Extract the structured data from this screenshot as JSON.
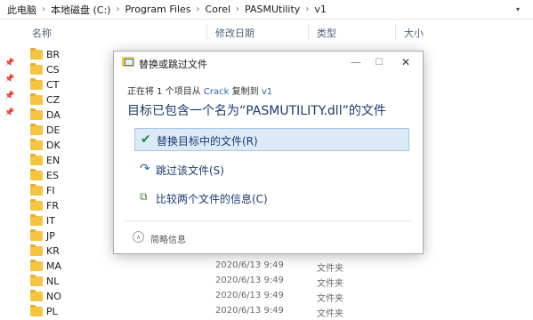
{
  "breadcrumb": [
    "此电脑",
    "本地磁盘 (C:)",
    "Program Files",
    "Corel",
    "PASMUtility",
    "v1"
  ],
  "columns": {
    "name": "名称",
    "modified": "修改日期",
    "type": "类型",
    "size": "大小"
  },
  "files": [
    {
      "name": "BR",
      "date": "",
      "type": ""
    },
    {
      "name": "CS",
      "date": "",
      "type": ""
    },
    {
      "name": "CT",
      "date": "",
      "type": ""
    },
    {
      "name": "CZ",
      "date": "",
      "type": ""
    },
    {
      "name": "DA",
      "date": "",
      "type": ""
    },
    {
      "name": "DE",
      "date": "",
      "type": ""
    },
    {
      "name": "DK",
      "date": "",
      "type": ""
    },
    {
      "name": "EN",
      "date": "",
      "type": ""
    },
    {
      "name": "ES",
      "date": "",
      "type": ""
    },
    {
      "name": "FI",
      "date": "",
      "type": ""
    },
    {
      "name": "FR",
      "date": "",
      "type": ""
    },
    {
      "name": "IT",
      "date": "",
      "type": ""
    },
    {
      "name": "JP",
      "date": "",
      "type": ""
    },
    {
      "name": "KR",
      "date": "",
      "type": ""
    },
    {
      "name": "MA",
      "date": "2020/6/13 9:49",
      "type": "文件夹"
    },
    {
      "name": "NL",
      "date": "2020/6/13 9:49",
      "type": "文件夹"
    },
    {
      "name": "NO",
      "date": "2020/6/13 9:49",
      "type": "文件夹"
    },
    {
      "name": "PL",
      "date": "2020/6/13 9:49",
      "type": "文件夹"
    }
  ],
  "dialog": {
    "title": "替换或跳过文件",
    "copy_prefix": "正在将 1 个项目从",
    "copy_source": "Crack",
    "copy_mid": "复制到",
    "copy_dest": "v1",
    "headline": "目标已包含一个名为“PASMUTILITY.dll”的文件",
    "option_replace": "替换目标中的文件(R)",
    "option_skip": "跳过该文件(S)",
    "option_compare": "比较两个文件的信息(C)",
    "details": "简略信息"
  },
  "colors": {
    "accent": "#2b63b5",
    "selected_bg": "#dceaf8",
    "folder": "#f5c542"
  },
  "icons": [
    "chevron-right-icon",
    "pin-icon",
    "folder-icon",
    "checkmark-icon",
    "skip-arrow-icon",
    "compare-files-icon",
    "collapse-chevron-icon"
  ]
}
